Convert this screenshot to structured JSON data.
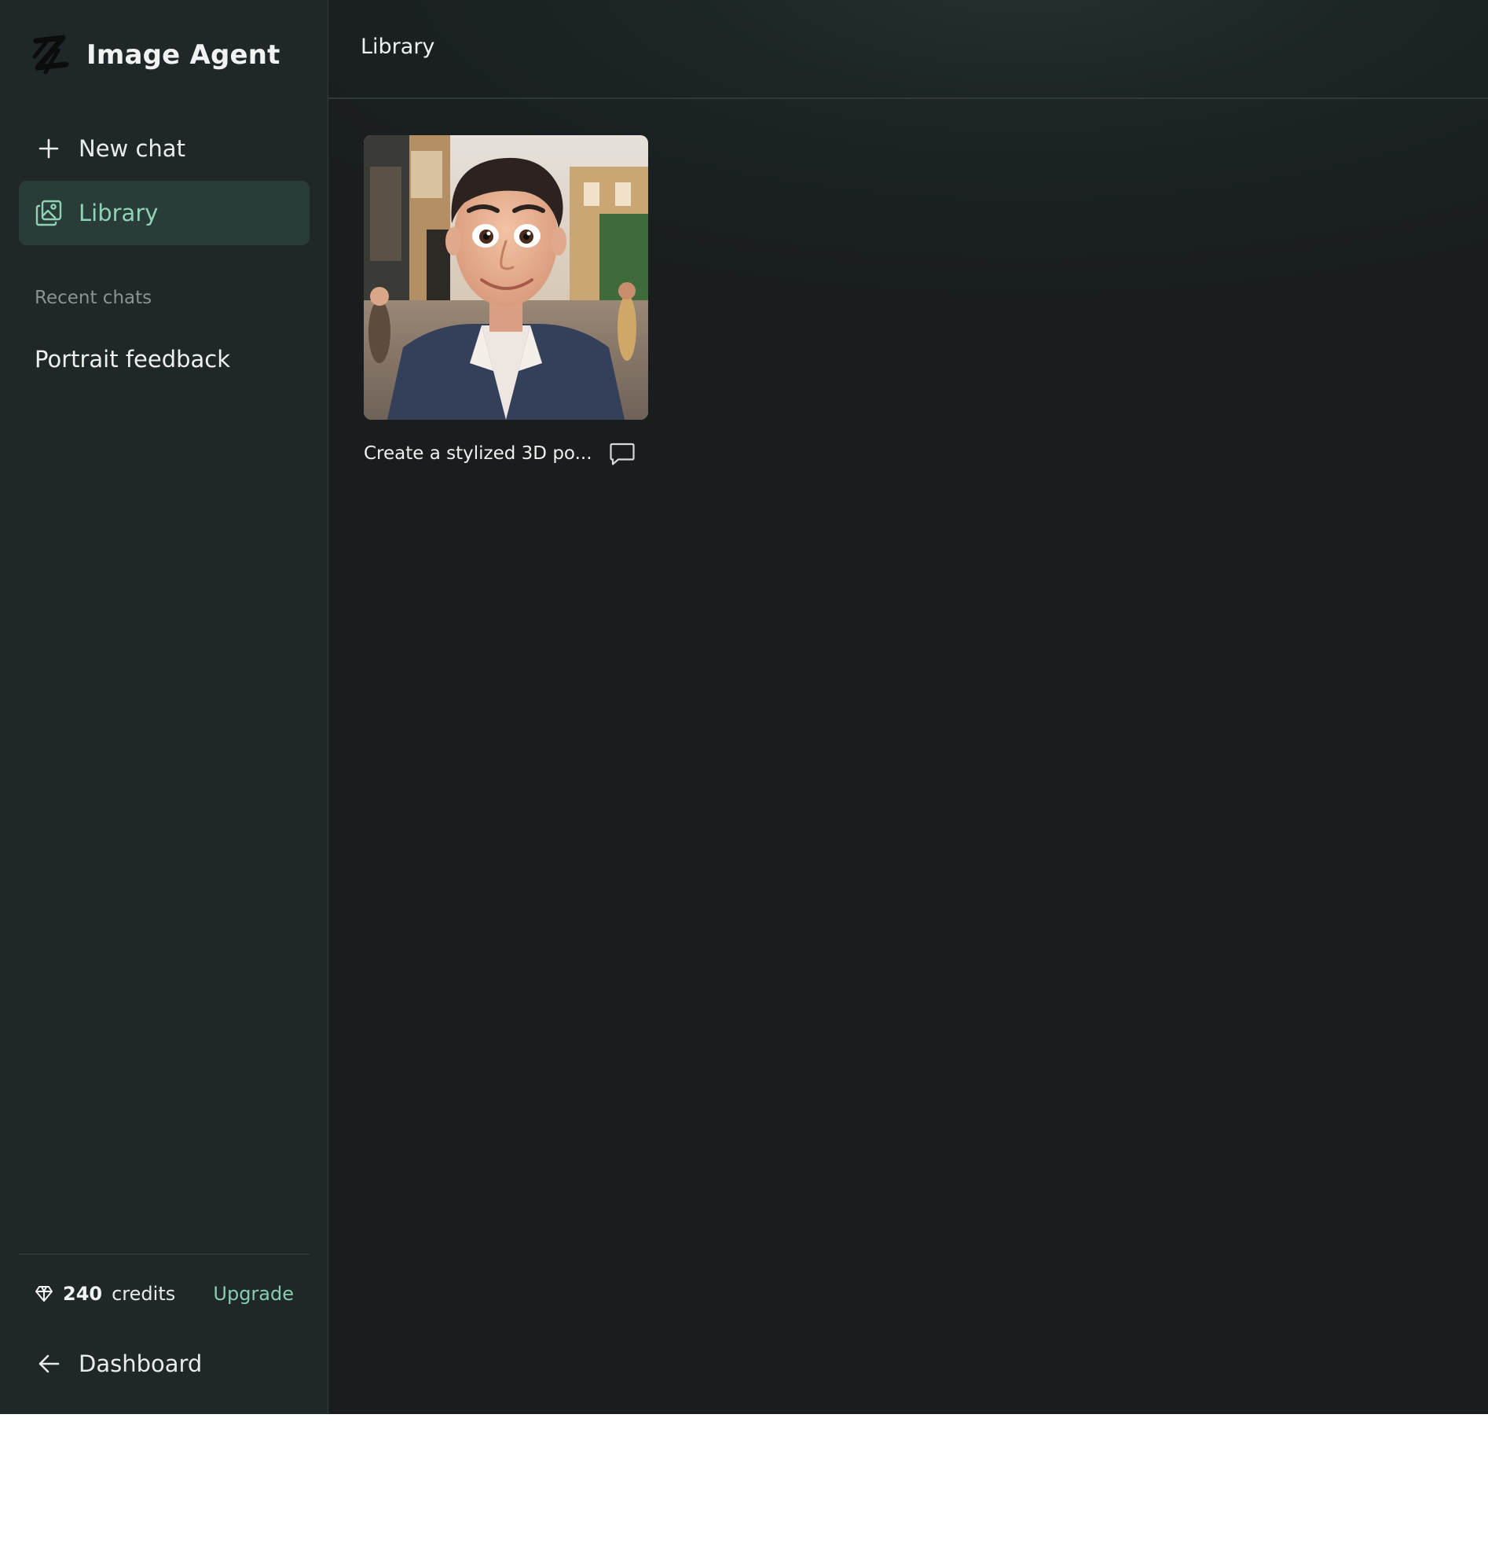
{
  "app": {
    "name": "Image Agent",
    "logo_icon": "brush-logo-icon"
  },
  "sidebar": {
    "new_chat": {
      "label": "New chat",
      "icon": "plus-icon"
    },
    "library": {
      "label": "Library",
      "icon": "images-icon",
      "active": true
    },
    "recent_chats_heading": "Recent chats",
    "recent_chats": [
      {
        "title": "Portrait feedback"
      }
    ],
    "credits": {
      "icon": "gem-icon",
      "count": "240",
      "unit": "credits",
      "upgrade_label": "Upgrade"
    },
    "dashboard": {
      "label": "Dashboard",
      "icon": "arrow-left-icon"
    }
  },
  "main": {
    "title": "Library",
    "items": [
      {
        "caption": "Create a stylized 3D po...",
        "thumbnail": "stylized 3D portrait of a smiling man on a city street",
        "action_icon": "chat-bubble-icon"
      }
    ]
  },
  "colors": {
    "sidebar_bg": "#202728",
    "main_bg": "#191d1e",
    "accent": "#8fd3b7",
    "active_item_bg": "#2a3c38"
  }
}
